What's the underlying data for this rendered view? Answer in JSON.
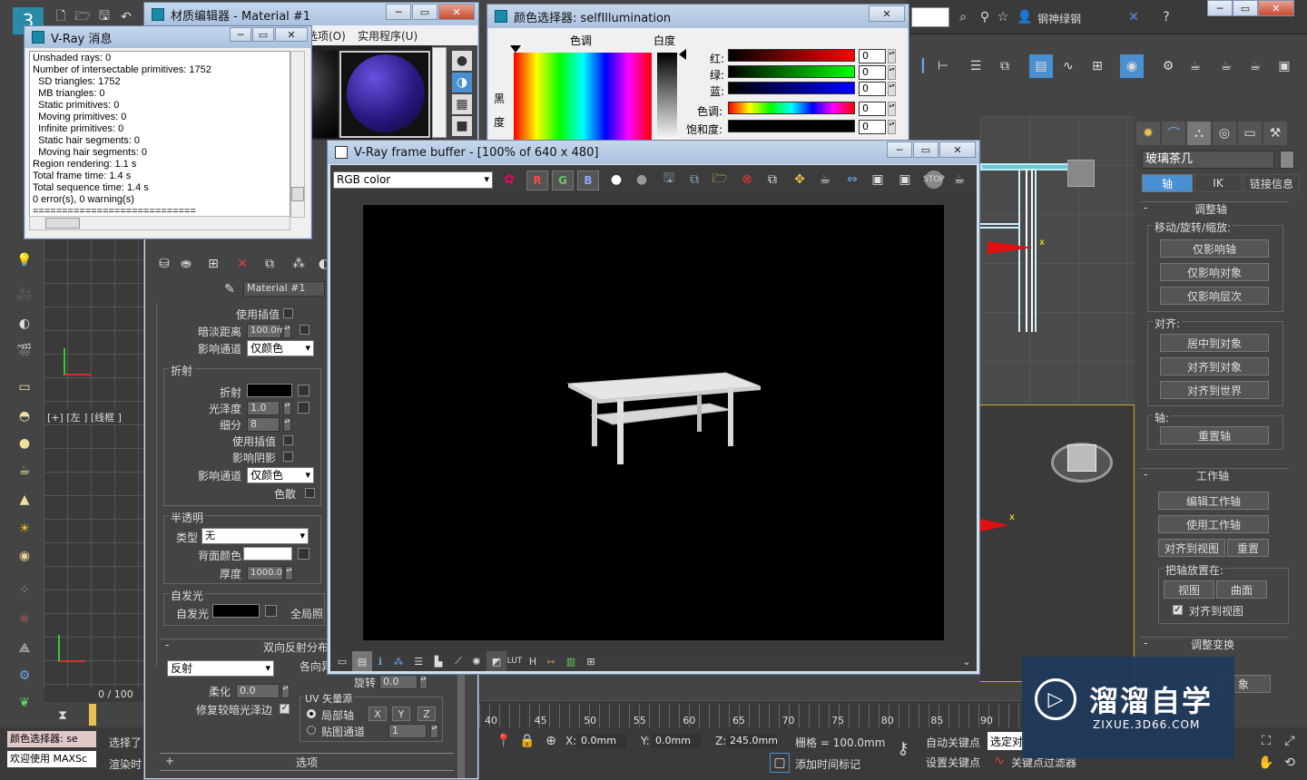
{
  "main_toolbar": {
    "user_name": "钢神绿钢",
    "ruler_numbers": [
      "40",
      "45",
      "50",
      "55",
      "60",
      "65",
      "70",
      "75",
      "80",
      "85",
      "90"
    ]
  },
  "vray_msg": {
    "title": "V-Ray 消息",
    "lines": [
      "Unshaded rays: 0",
      "Number of intersectable primitives: 1752",
      "  SD triangles: 1752",
      "  MB triangles: 0",
      "  Static primitives: 0",
      "  Moving primitives: 0",
      "  Infinite primitives: 0",
      "  Static hair segments: 0",
      "  Moving hair segments: 0",
      "Region rendering: 1.1 s",
      "Total frame time: 1.4 s",
      "Total sequence time: 1.4 s",
      "0 error(s), 0 warning(s)",
      "============================"
    ]
  },
  "mat_editor": {
    "title": "材质编辑器 - Material #1",
    "menu": [
      "选项(O)",
      "实用程序(U)"
    ],
    "material_name": "Material #1",
    "use_interp": "使用插值",
    "dim_dist": "暗淡距离",
    "dim_dist_val": "100.0m",
    "affect_channel": "影响通道",
    "affect_channel_val": "仅颜色",
    "refraction_group": "折射",
    "refraction": "折射",
    "glossiness": "光泽度",
    "glossiness_val": "1.0",
    "subdivs": "细分",
    "subdivs_val": "8",
    "use_interp2": "使用插值",
    "affect_shadows": "影响阴影",
    "affect_channel2": "影响通道",
    "affect_channel2_val": "仅颜色",
    "dispersion": "色散",
    "translucency_group": "半透明",
    "type": "类型",
    "type_val": "无",
    "back_color": "背面颜色",
    "thickness": "厚度",
    "thickness_val": "1000.0",
    "selfillum_group": "自发光",
    "selfillum": "自发光",
    "gi": "全局照",
    "brdf_rollout": "双向反射分布",
    "brdf_type": "反射",
    "anisotropy": "各向异",
    "rotation": "旋转",
    "rotation_val": "0.0",
    "soften": "柔化",
    "soften_val": "0.0",
    "fix_dark": "修复较暗光泽边",
    "uv_source": "UV 矢量源",
    "local_axis": "局部轴",
    "map_channel": "贴图通道",
    "map_channel_val": "1",
    "axis_x": "X",
    "axis_y": "Y",
    "axis_z": "Z",
    "options_rollout": "选项"
  },
  "color_picker": {
    "title": "颜色选择器: selfIllumination",
    "hue_label": "色调",
    "white_label": "白度",
    "black_label": "黑",
    "degree_label": "度",
    "red": "红:",
    "green": "绿:",
    "blue": "蓝:",
    "hue": "色调:",
    "saturation": "饱和度:",
    "red_val": "0",
    "green_val": "0",
    "blue_val": "0",
    "hue_val": "0",
    "sat_val": "0"
  },
  "vfb": {
    "title": "V-Ray frame buffer - [100% of 640 x 480]",
    "channel": "RGB color",
    "r": "R",
    "g": "G",
    "b": "B"
  },
  "left_viewport": {
    "label": "[+] [左 ] [线框 ]",
    "frame": "0 / 100"
  },
  "command_panel": {
    "object_name": "玻璃茶几",
    "tabs": [
      "轴",
      "IK",
      "链接信息"
    ],
    "adjust_pivot": "调整轴",
    "move_rotate_scale": "移动/旋转/缩放:",
    "affect_pivot_only": "仅影响轴",
    "affect_object_only": "仅影响对象",
    "affect_hierarchy_only": "仅影响层次",
    "alignment": "对齐:",
    "center_to_object": "居中到对象",
    "align_to_object": "对齐到对象",
    "align_to_world": "对齐到世界",
    "pivot": "轴:",
    "reset_pivot": "重置轴",
    "working_pivot": "工作轴",
    "edit_working_pivot": "编辑工作轴",
    "use_working_pivot": "使用工作轴",
    "align_to_view": "对齐到视图",
    "reset": "重置",
    "place_pivot_to": "把轴放置在:",
    "view": "视图",
    "surface": "曲面",
    "align_to_view_chk": "对齐到视图",
    "adjust_transform": "调整变换",
    "partial_object": "象"
  },
  "status": {
    "color_picker_label": "颜色选择器: se",
    "welcome": "欢迎使用 MAXSc",
    "select": "选择了",
    "render_time": "渲染时",
    "x_label": "X:",
    "x_val": "0.0mm",
    "y_label": "Y:",
    "y_val": "0.0mm",
    "z_label": "Z:",
    "z_val": "245.0mm",
    "grid": "栅格 = 100.0mm",
    "auto_key": "自动关键点",
    "selected_obj": "选定对",
    "set_key": "设置关键点",
    "key_filter": "关键点过滤器",
    "add_time_tag": "添加时间标记"
  },
  "watermark": {
    "brand": "溜溜自学",
    "url": "ZIXUE.3D66.COM"
  },
  "colors": {
    "accent_blue": "#4a8fd0",
    "viewport_yellow": "#c8a830",
    "dark_bg": "#444444"
  }
}
